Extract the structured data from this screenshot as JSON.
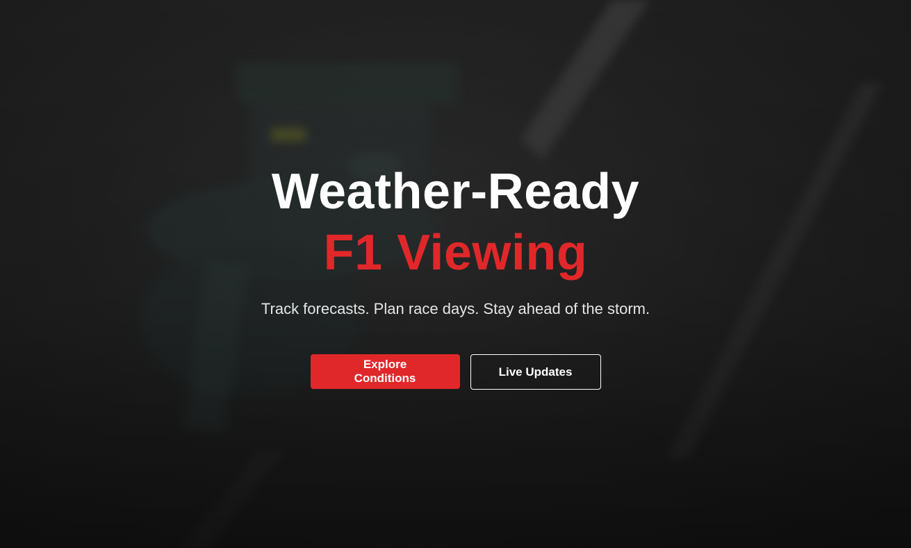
{
  "hero": {
    "headline_line1": "Weather-Ready",
    "headline_line2": "F1 Viewing",
    "tagline": "Track forecasts. Plan race days. Stay ahead of the storm.",
    "primary_cta": "Explore Conditions",
    "secondary_cta": "Live Updates"
  },
  "colors": {
    "accent": "#e0282a",
    "background": "#1f1f1f",
    "text": "#ffffff"
  }
}
